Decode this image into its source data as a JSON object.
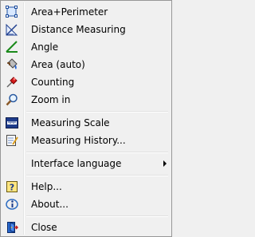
{
  "menu": {
    "items": [
      {
        "id": "area-perimeter",
        "label": "Area+Perimeter",
        "icon": "area-perimeter-icon"
      },
      {
        "id": "distance-measuring",
        "label": "Distance Measuring",
        "icon": "ruler-icon"
      },
      {
        "id": "angle",
        "label": "Angle",
        "icon": "angle-icon"
      },
      {
        "id": "area-auto",
        "label": "Area (auto)",
        "icon": "paint-bucket-icon"
      },
      {
        "id": "counting",
        "label": "Counting",
        "icon": "pushpin-icon"
      },
      {
        "id": "zoom-in",
        "label": "Zoom in",
        "icon": "magnifier-icon"
      },
      {
        "id": "measuring-scale",
        "label": "Measuring Scale",
        "icon": "scale-icon"
      },
      {
        "id": "measuring-history",
        "label": "Measuring History...",
        "icon": "notepad-icon"
      },
      {
        "id": "interface-language",
        "label": "Interface language",
        "icon": ""
      },
      {
        "id": "help",
        "label": "Help...",
        "icon": "help-icon"
      },
      {
        "id": "about",
        "label": "About...",
        "icon": "info-icon"
      },
      {
        "id": "close",
        "label": "Close",
        "icon": "exit-door-icon"
      }
    ]
  },
  "colors": {
    "menu_background": "#f0f0f0",
    "menu_border": "#979797",
    "text": "#000000"
  }
}
